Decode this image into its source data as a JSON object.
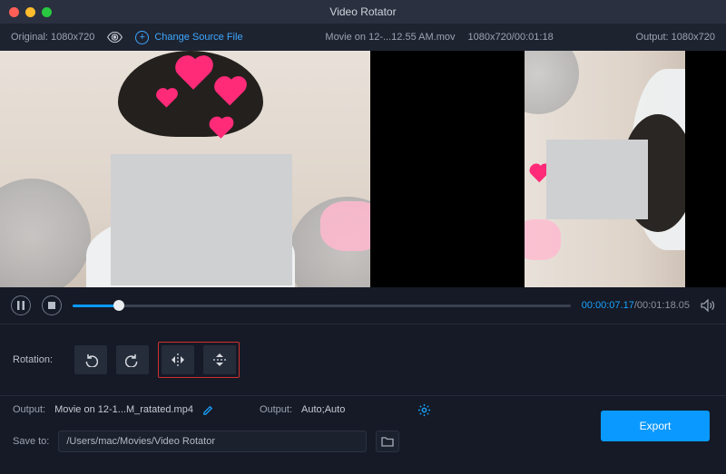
{
  "title": "Video Rotator",
  "toolbar": {
    "original_label": "Original: 1080x720",
    "change_source": "Change Source File",
    "filename": "Movie on 12-...12.55 AM.mov",
    "meta": "1080x720/00:01:18",
    "output_label": "Output: 1080x720"
  },
  "transport": {
    "current": "00:00:07.17",
    "total": "/00:01:18.05"
  },
  "rotation": {
    "label": "Rotation:"
  },
  "output": {
    "label1": "Output:",
    "filename": "Movie on 12-1...M_ratated.mp4",
    "label2": "Output:",
    "preset": "Auto;Auto"
  },
  "save": {
    "label": "Save to:",
    "path": "/Users/mac/Movies/Video Rotator"
  },
  "export_label": "Export"
}
